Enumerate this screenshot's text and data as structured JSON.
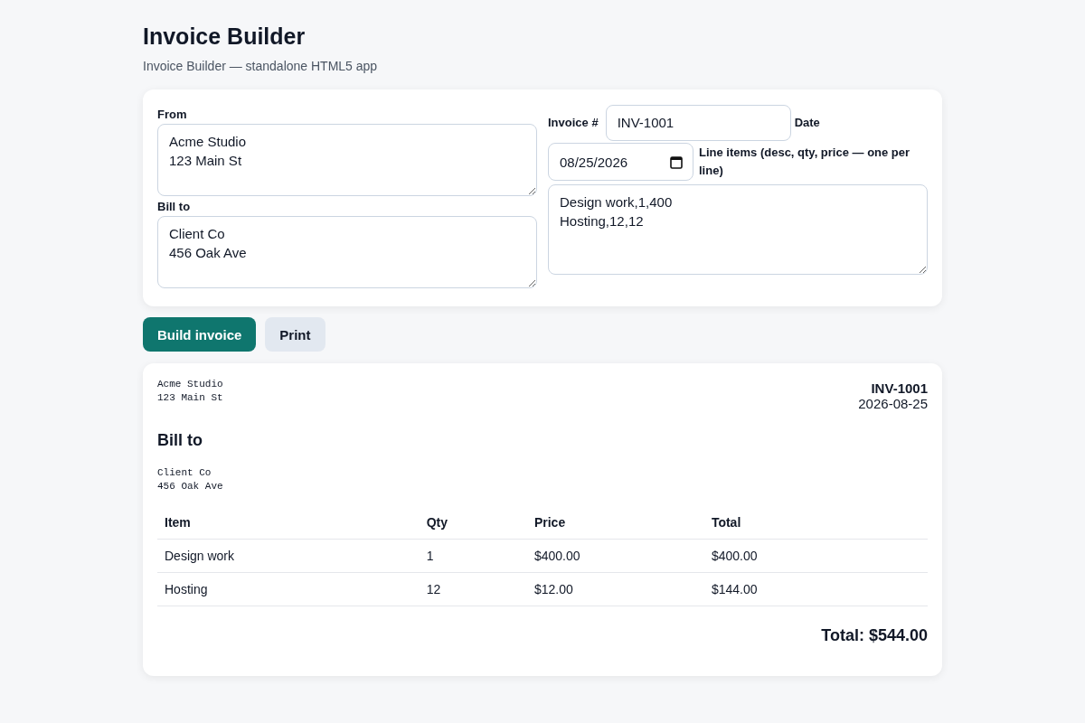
{
  "app": {
    "title": "Invoice Builder",
    "subtitle": "Invoice Builder — standalone HTML5 app"
  },
  "form": {
    "from": {
      "label": "From",
      "value": "Acme Studio\n123 Main St"
    },
    "bill_to": {
      "label": "Bill to",
      "value": "Client Co\n456 Oak Ave"
    },
    "invoice_no": {
      "label": "Invoice #",
      "value": "INV-1001"
    },
    "date": {
      "label": "Date",
      "value": "08/25/2026"
    },
    "line_items": {
      "label": "Line items (desc, qty, price — one per line)",
      "value": "Design work,1,400\nHosting,12,12"
    }
  },
  "buttons": [
    {
      "label": "Build invoice",
      "kind": "primary"
    },
    {
      "label": "Print",
      "kind": "secondary"
    }
  ],
  "invoice": {
    "from": "Acme Studio\n123 Main St",
    "number": "INV-1001",
    "date": "2026-08-25",
    "bill_to_heading": "Bill to",
    "bill_to": "Client Co\n456 Oak Ave",
    "table": {
      "columns": [
        "Item",
        "Qty",
        "Price",
        "Total"
      ],
      "rows": [
        [
          "Design work",
          "1",
          "$400.00",
          "$400.00"
        ],
        [
          "Hosting",
          "12",
          "$12.00",
          "$144.00"
        ]
      ]
    },
    "total": "Total: $544.00"
  }
}
